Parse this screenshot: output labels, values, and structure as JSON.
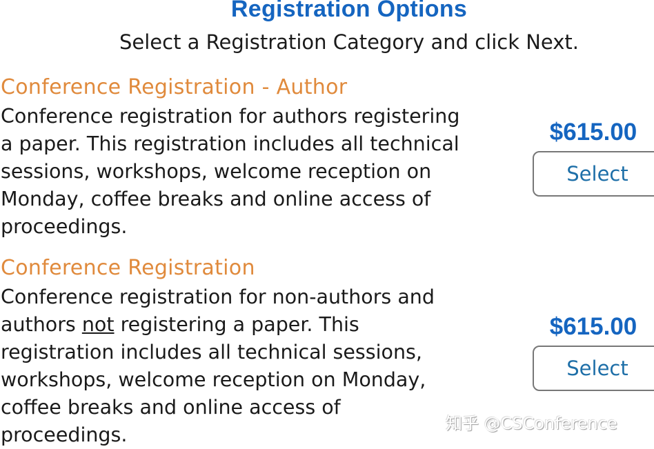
{
  "header": {
    "title": "Registration Options",
    "subtitle": "Select a Registration Category and click Next."
  },
  "options": [
    {
      "title": "Conference Registration - Author",
      "description_lines": [
        "Conference registration for authors registering",
        "a paper. This registration includes all technical",
        "sessions, workshops, welcome reception on",
        "Monday, coffee breaks and online access of",
        "proceedings."
      ],
      "price": "$615.00",
      "select_label": "Select"
    },
    {
      "title": "Conference Registration",
      "description_parts": {
        "line1": "Conference registration for non-authors and",
        "line2_before": "authors ",
        "line2_underlined": "not",
        "line2_after": " registering a paper. This",
        "line3": "registration includes all technical sessions,",
        "line4": "workshops, welcome reception on Monday,",
        "line5": "coffee breaks and online access of",
        "line6": "proceedings."
      },
      "price": "$615.00",
      "select_label": "Select"
    }
  ],
  "watermark": "知乎 @CSConference",
  "colors": {
    "title_blue": "#1565c0",
    "option_orange": "#e08a3c",
    "button_text": "#1e6fa8",
    "button_border": "#777777"
  }
}
